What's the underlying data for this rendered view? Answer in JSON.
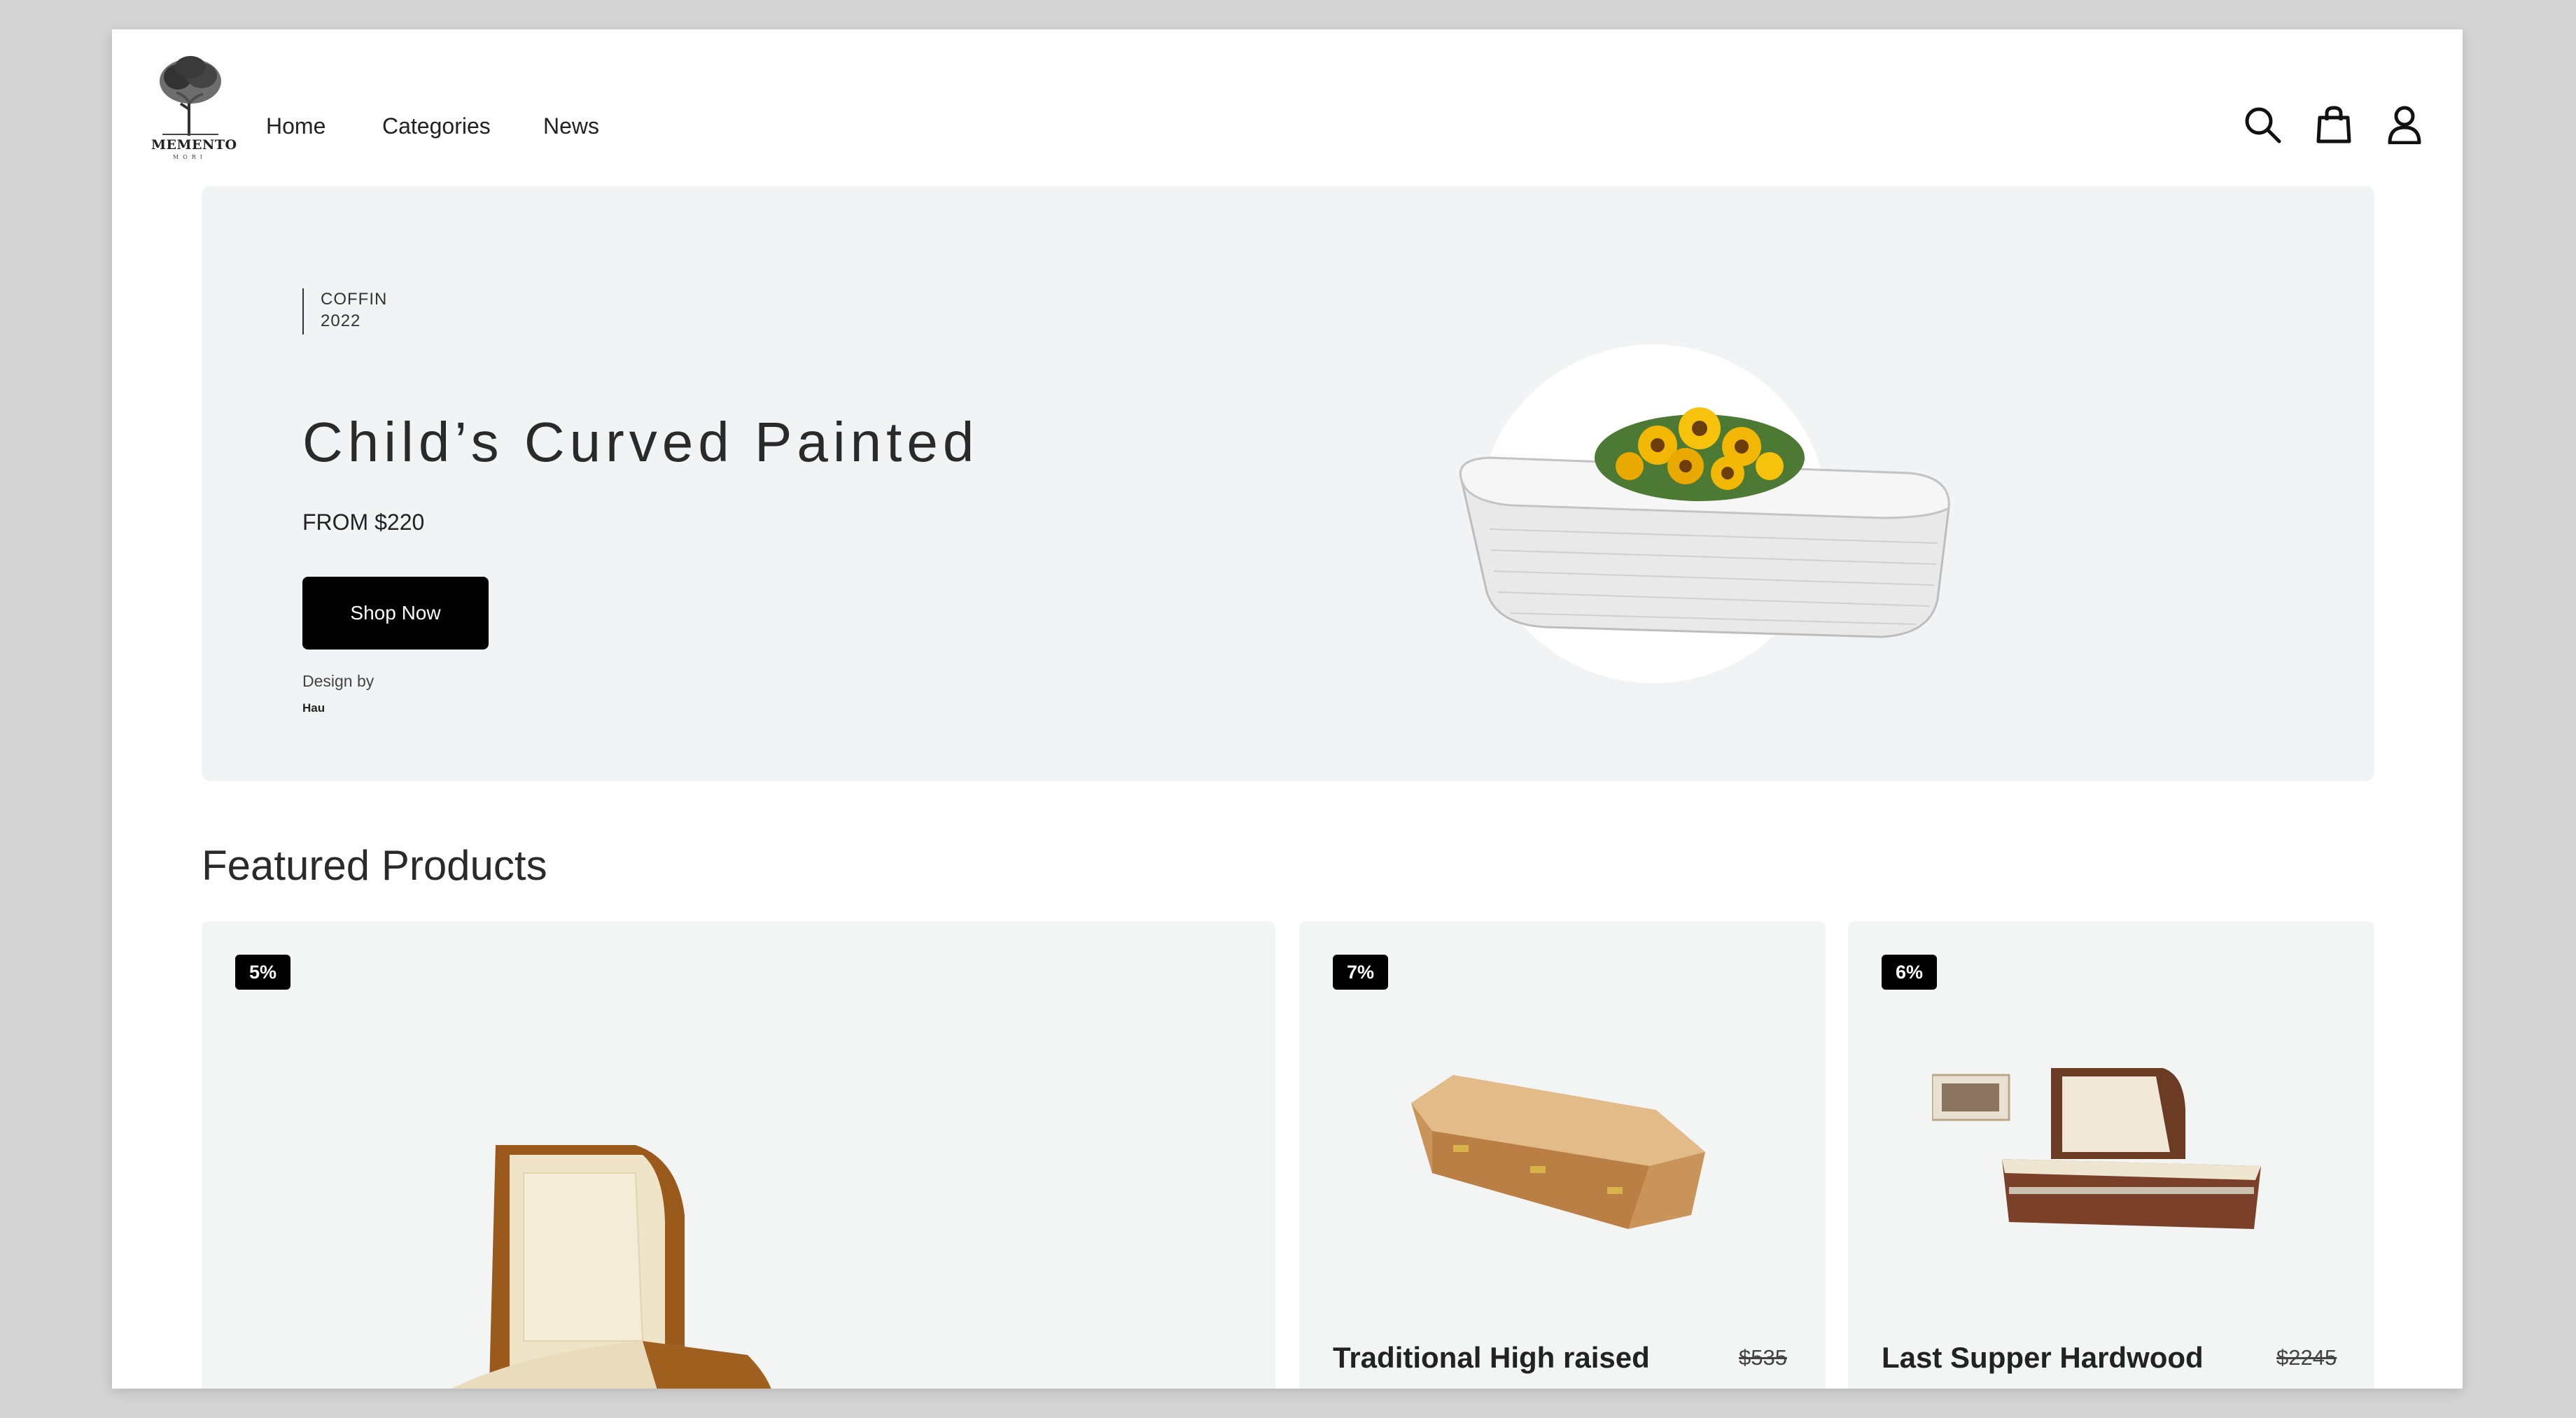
{
  "header": {
    "logo_name": "MEMENTO",
    "logo_sub": "MORI",
    "nav": [
      "Home",
      "Categories",
      "News"
    ],
    "icons": [
      "search-icon",
      "shopping-bag-icon",
      "user-icon"
    ]
  },
  "hero": {
    "tag_line1": "COFFIN",
    "tag_line2": "2022",
    "title": "Child’s Curved Painted",
    "price": "FROM $220",
    "cta": "Shop Now",
    "design_by_label": "Design by",
    "designer": "Hau"
  },
  "featured": {
    "title": "Featured Products",
    "products": [
      {
        "badge": "5%",
        "name": "",
        "old_price": ""
      },
      {
        "badge": "7%",
        "name": "Traditional High raised",
        "old_price": "$535"
      },
      {
        "badge": "6%",
        "name": "Last Supper Hardwood",
        "old_price": "$2245"
      }
    ]
  },
  "colors": {
    "page_bg": "#d4d4d4",
    "hero_bg": "#f2f3f5",
    "card_bg": "#f3f4f4",
    "accent": "#000000"
  }
}
